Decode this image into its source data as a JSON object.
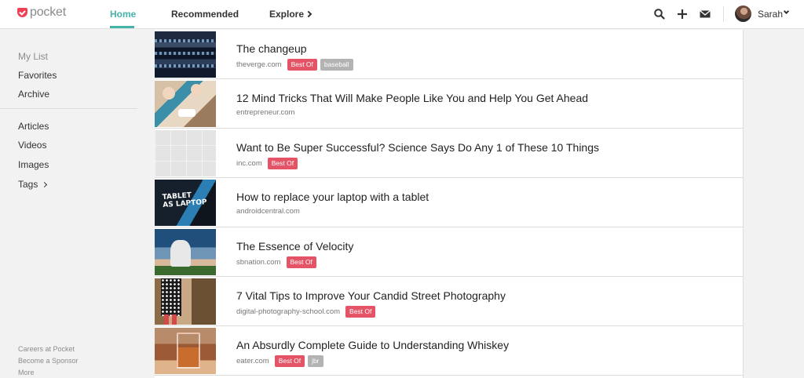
{
  "app": {
    "logo_text": "pocket"
  },
  "nav": {
    "tabs": [
      {
        "label": "Home",
        "active": true
      },
      {
        "label": "Recommended",
        "active": false
      },
      {
        "label": "Explore",
        "active": false
      }
    ]
  },
  "header_actions": {
    "icons": [
      "search-icon",
      "add-icon",
      "mail-icon"
    ]
  },
  "user": {
    "name": "Sarah"
  },
  "sidebar": {
    "heading": "My List",
    "items": [
      "Favorites",
      "Archive"
    ],
    "filters": [
      "Articles",
      "Videos",
      "Images",
      "Tags"
    ],
    "footer": [
      "Careers at Pocket",
      "Become a Sponsor",
      "More"
    ]
  },
  "articles": [
    {
      "title": "The changeup",
      "domain": "theverge.com",
      "tags": [
        "Best Of",
        "baseball"
      ]
    },
    {
      "title": "12 Mind Tricks That Will Make People Like You and Help You Get Ahead",
      "domain": "entrepreneur.com",
      "tags": []
    },
    {
      "title": "Want to Be Super Successful? Science Says Do Any 1 of These 10 Things",
      "domain": "inc.com",
      "tags": [
        "Best Of"
      ]
    },
    {
      "title": "How to replace your laptop with a tablet",
      "domain": "androidcentral.com",
      "tags": [],
      "thumb_text": "TABLET AS LAPTOP"
    },
    {
      "title": "The Essence of Velocity",
      "domain": "sbnation.com",
      "tags": [
        "Best Of"
      ]
    },
    {
      "title": "7 Vital Tips to Improve Your Candid Street Photography",
      "domain": "digital-photography-school.com",
      "tags": [
        "Best Of"
      ]
    },
    {
      "title": "An Absurdly Complete Guide to Understanding Whiskey",
      "domain": "eater.com",
      "tags": [
        "Best Of",
        "jbr"
      ]
    }
  ],
  "colors": {
    "accent": "#44b3a9",
    "brand": "#ef4056",
    "badge_red": "#e45366",
    "badge_gray": "#b3b3b3"
  }
}
